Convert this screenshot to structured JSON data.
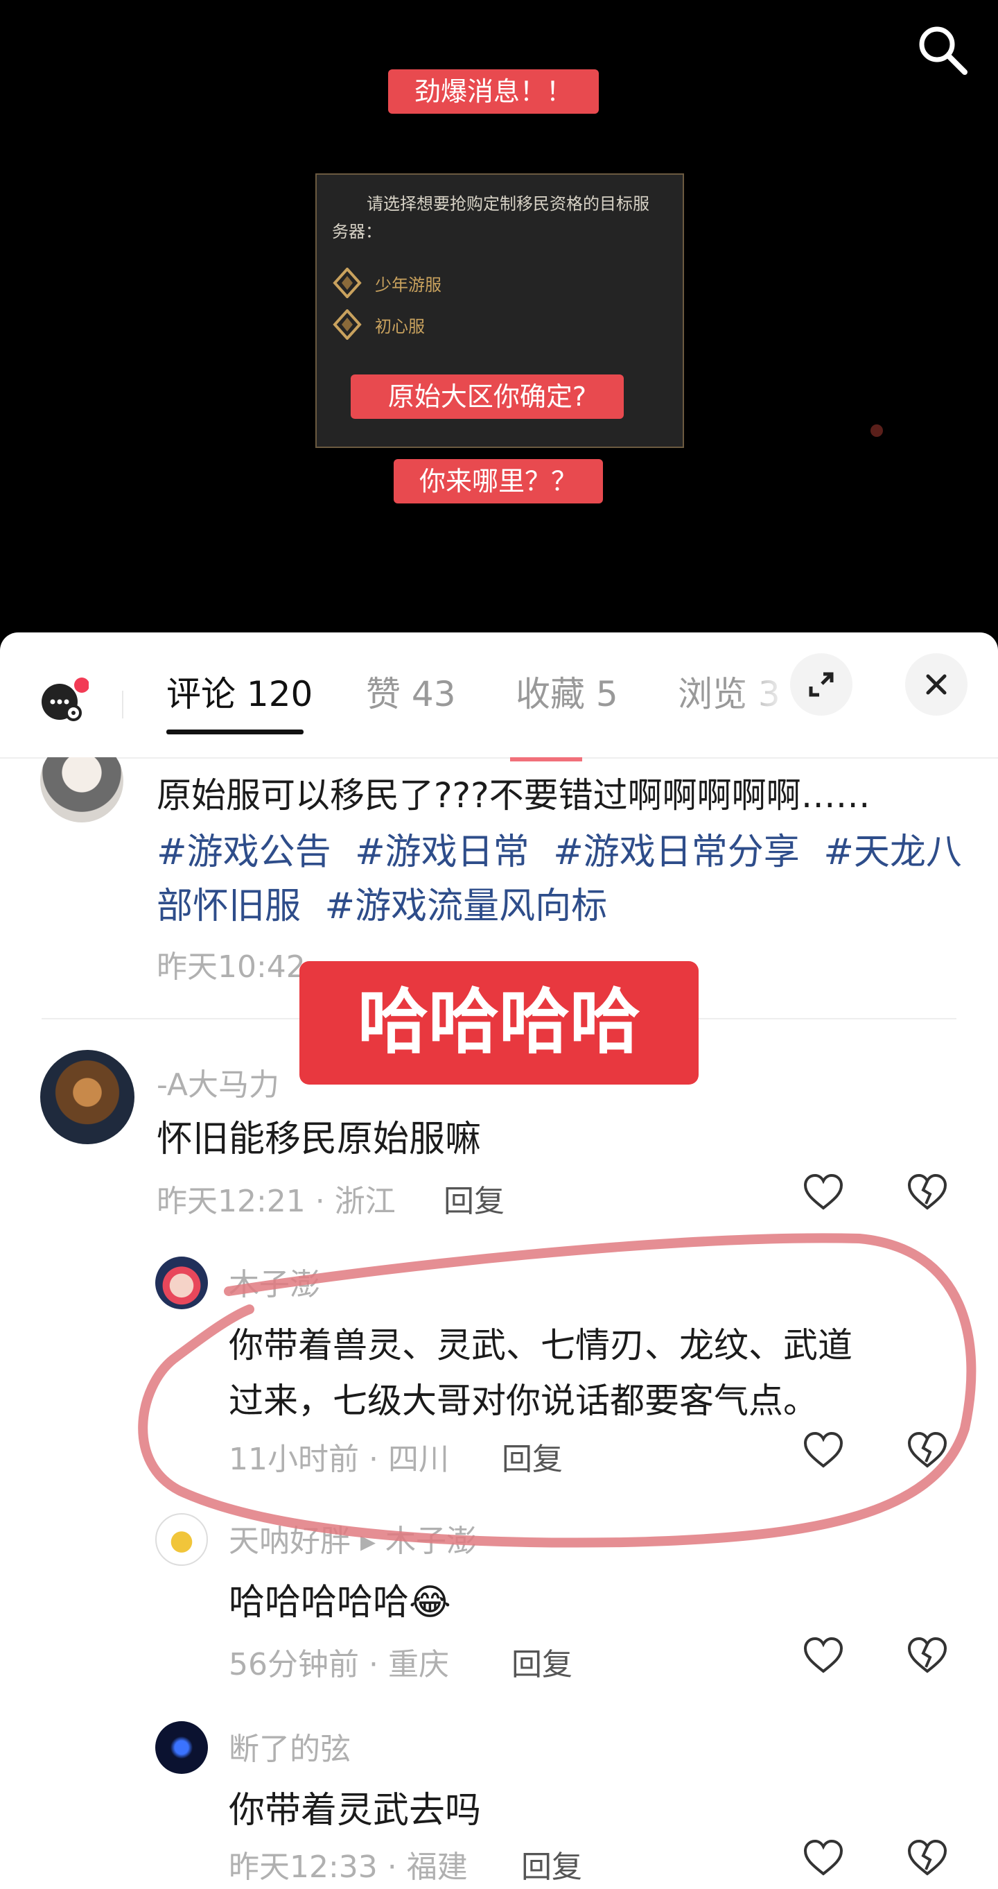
{
  "video": {
    "label_top": "劲爆消息！！",
    "panel_prompt": "请选择想要抢购定制移民资格的目标服务器：",
    "server_options": [
      "少年游服",
      "初心服"
    ],
    "label_middle": "原始大区你确定?",
    "label_bottom": "你来哪里？？"
  },
  "tabs": [
    {
      "label": "评论 120",
      "active": true
    },
    {
      "label": "赞 43"
    },
    {
      "label": "收藏 5"
    },
    {
      "label": "浏览 3"
    }
  ],
  "post": {
    "text": "原始服可以移民了???不要错过啊啊啊啊啊……",
    "tags": [
      "#游戏公告",
      "#游戏日常",
      "#游戏日常分享",
      "#天龙八部怀旧服",
      "#游戏流量风向标"
    ],
    "time": "昨天10:42"
  },
  "overlay_label": "哈哈哈哈",
  "comments": [
    {
      "user": "-A大马力",
      "text": "怀旧能移民原始服嘛",
      "meta": "昨天12:21 · 浙江",
      "reply": "回复"
    },
    {
      "user": "木子澎",
      "text_line1": "你带着兽灵、灵武、七情刃、龙纹、武道",
      "text_line2": "过来，七级大哥对你说话都要客气点。",
      "meta": "11小时前 · 四川",
      "reply": "回复"
    },
    {
      "user": "天呐好胖 ▸ 木子澎",
      "text": "哈哈哈哈哈😂",
      "meta": "56分钟前 · 重庆",
      "reply": "回复"
    },
    {
      "user": "断了的弦",
      "text": "你带着灵武去吗",
      "meta": "昨天12:33 · 福建",
      "reply": "回复"
    }
  ],
  "icons": {
    "search": "search-icon",
    "chat": "chat-settings-icon",
    "expand": "expand-icon",
    "close": "close-icon",
    "like": "heart-icon",
    "dislike": "broken-heart-icon"
  },
  "colors": {
    "accent_red": "#e84a4f",
    "tag_blue": "#2e4d8a",
    "annotation": "#e07a80"
  }
}
